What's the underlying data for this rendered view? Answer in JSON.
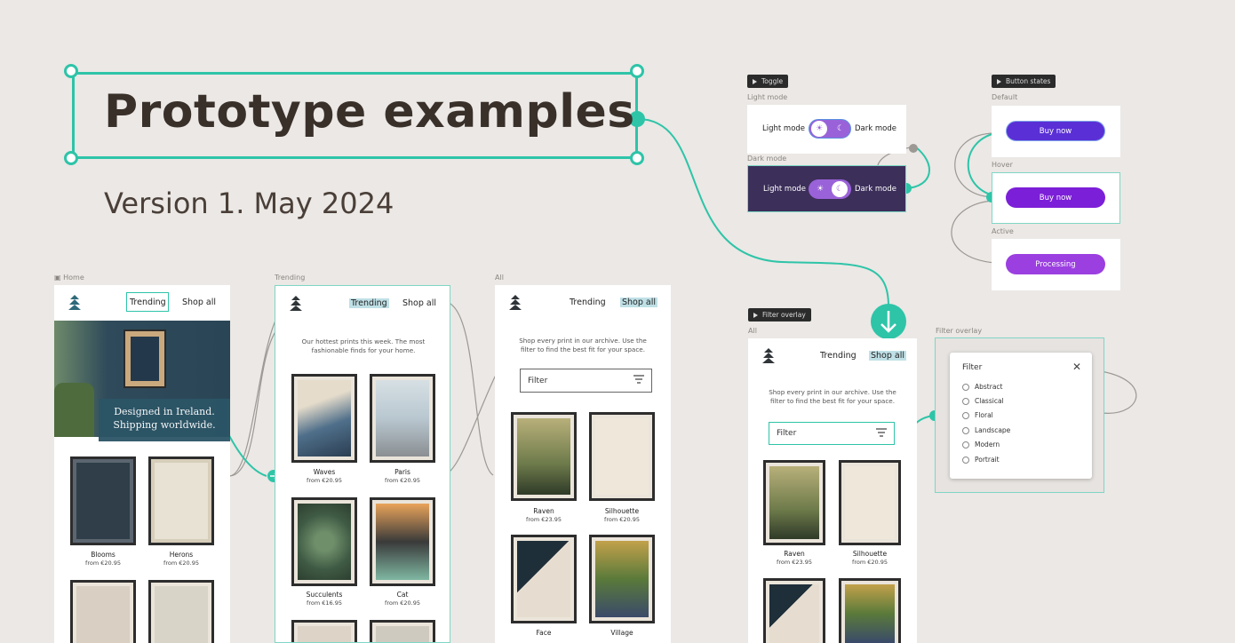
{
  "title": "Prototype examples",
  "subtitle": "Version 1. May 2024",
  "frames": {
    "home": {
      "label": "Home",
      "nav": {
        "trending": "Trending",
        "shop_all": "Shop all"
      },
      "hero_line1": "Designed in Ireland.",
      "hero_line2": "Shipping worldwide.",
      "products": [
        {
          "name": "Blooms",
          "price": "from €20.95"
        },
        {
          "name": "Herons",
          "price": "from €20.95"
        }
      ]
    },
    "trending": {
      "label": "Trending",
      "nav": {
        "trending": "Trending",
        "shop_all": "Shop all"
      },
      "intro": "Our hottest prints this week. The most fashionable finds for your home.",
      "products": [
        {
          "name": "Waves",
          "price": "from €20.95"
        },
        {
          "name": "Paris",
          "price": "from €20.95"
        },
        {
          "name": "Succulents",
          "price": "from €16.95"
        },
        {
          "name": "Cat",
          "price": "from €20.95"
        }
      ]
    },
    "all": {
      "label": "All",
      "nav": {
        "trending": "Trending",
        "shop_all": "Shop all"
      },
      "intro": "Shop every print in our archive. Use the filter to find the best fit for your space.",
      "filter_label": "Filter",
      "products": [
        {
          "name": "Raven",
          "price": "from €23.95"
        },
        {
          "name": "Silhouette",
          "price": "from €20.95"
        },
        {
          "name": "Face",
          "price": ""
        },
        {
          "name": "Village",
          "price": ""
        }
      ]
    },
    "filter_demo": {
      "tag": "Filter overlay",
      "label": "All",
      "nav": {
        "trending": "Trending",
        "shop_all": "Shop all"
      },
      "intro": "Shop every print in our archive. Use the filter to find the best fit for your space.",
      "filter_label": "Filter",
      "products": [
        {
          "name": "Raven",
          "price": "from €23.95"
        },
        {
          "name": "Silhouette",
          "price": "from €20.95"
        }
      ]
    },
    "filter_overlay": {
      "label": "Filter overlay",
      "title": "Filter",
      "options": [
        "Abstract",
        "Classical",
        "Floral",
        "Landscape",
        "Modern",
        "Portrait"
      ]
    },
    "toggle": {
      "tag": "Toggle",
      "light_label": "Light mode",
      "dark_label": "Dark mode",
      "toggle_light_text": "Light mode",
      "toggle_dark_text": "Dark mode"
    },
    "button_states": {
      "tag": "Button states",
      "default_label": "Default",
      "hover_label": "Hover",
      "active_label": "Active",
      "default_text": "Buy now",
      "hover_text": "Buy now",
      "active_text": "Processing"
    }
  },
  "colors": {
    "accent": "#2ec4a8",
    "background": "#ebe8e5",
    "button_purple": "#5a2fd6",
    "button_hover": "#7c1fd8",
    "button_active": "#9b3fe0",
    "toggle_purple": "#9a62d8",
    "dark_frame": "#3c2f5a"
  }
}
